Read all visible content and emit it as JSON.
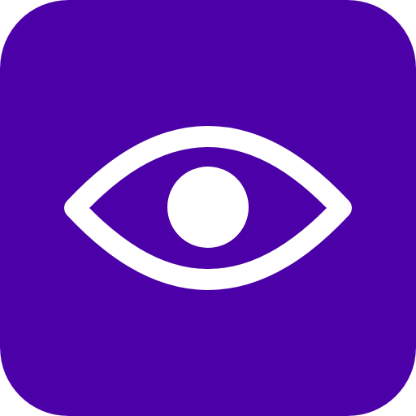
{
  "app_icon": {
    "icon": "eye-icon",
    "background_color": "#4B00A8",
    "glyph_color": "#FFFFFF"
  }
}
